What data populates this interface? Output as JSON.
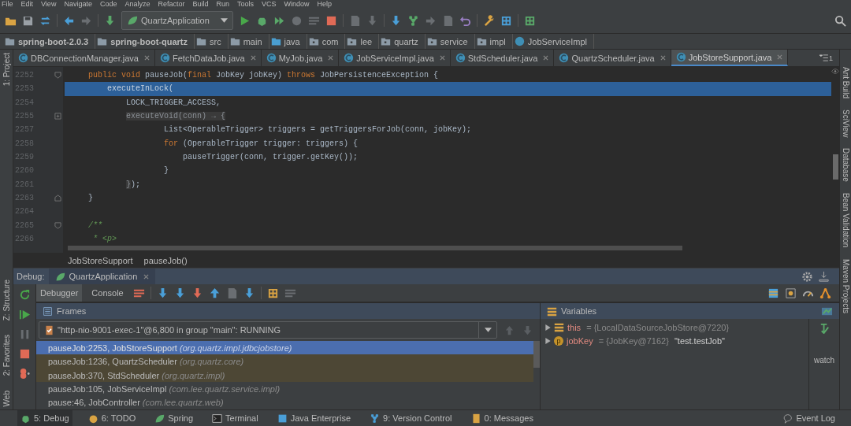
{
  "menu": [
    "File",
    "Edit",
    "View",
    "Navigate",
    "Code",
    "Analyze",
    "Refactor",
    "Build",
    "Run",
    "Tools",
    "VCS",
    "Window",
    "Help"
  ],
  "run_config": {
    "label": "QuartzApplication"
  },
  "breadcrumbs": [
    {
      "label": "spring-boot-2.0.3",
      "kind": "module"
    },
    {
      "label": "spring-boot-quartz",
      "kind": "module"
    },
    {
      "label": "src",
      "kind": "folder"
    },
    {
      "label": "main",
      "kind": "folder"
    },
    {
      "label": "java",
      "kind": "source"
    },
    {
      "label": "com",
      "kind": "package"
    },
    {
      "label": "lee",
      "kind": "package"
    },
    {
      "label": "quartz",
      "kind": "package"
    },
    {
      "label": "service",
      "kind": "package"
    },
    {
      "label": "impl",
      "kind": "package"
    },
    {
      "label": "JobServiceImpl",
      "kind": "class"
    }
  ],
  "left_toolbar": {
    "top": [
      "1: Project"
    ],
    "bottom": [
      "Z: Structure",
      "2: Favorites",
      "Web"
    ]
  },
  "right_toolbar": [
    "Ant Build",
    "SciView",
    "Database",
    "Bean Validation",
    "Maven Projects"
  ],
  "tabs": [
    {
      "label": "DBConnectionManager.java",
      "selected": false
    },
    {
      "label": "FetchDataJob.java",
      "selected": false
    },
    {
      "label": "MyJob.java",
      "selected": false
    },
    {
      "label": "JobServiceImpl.java",
      "selected": false
    },
    {
      "label": "StdScheduler.java",
      "selected": false
    },
    {
      "label": "QuartzScheduler.java",
      "selected": false
    },
    {
      "label": "JobStoreSupport.java",
      "selected": true
    }
  ],
  "tab_overflow": "1",
  "code": [
    {
      "number": "2252",
      "current": false,
      "fold_start": true,
      "segments": [
        {
          "text": "    public void ",
          "kind": "kw"
        },
        {
          "text": "pauseJob(",
          "kind": "plain"
        },
        {
          "text": "final ",
          "kind": "kw"
        },
        {
          "text": "JobKey jobKey) ",
          "kind": "plain"
        },
        {
          "text": "throws ",
          "kind": "kw"
        },
        {
          "text": "JobPersistenceException {",
          "kind": "plain"
        }
      ]
    },
    {
      "number": "2253",
      "current": true,
      "segments": [
        {
          "text": "        executeInLock(",
          "kind": "plain"
        }
      ]
    },
    {
      "number": "2254",
      "current": false,
      "segments": [
        {
          "text": "            LOCK_TRIGGER_ACCESS,",
          "kind": "plain"
        }
      ]
    },
    {
      "number": "2255",
      "current": false,
      "folded": true,
      "segments": [
        {
          "text": "            executeVoid(conn) → {",
          "kind": "folded"
        }
      ]
    },
    {
      "number": "2257",
      "current": false,
      "segments": [
        {
          "text": "                    List<OperableTrigger> triggers = getTriggersForJob(conn, jobKey);",
          "kind": "plain"
        }
      ]
    },
    {
      "number": "2258",
      "current": false,
      "segments": [
        {
          "text": "                    for ",
          "kind": "kw"
        },
        {
          "text": "(OperableTrigger trigger: triggers) {",
          "kind": "plain"
        }
      ]
    },
    {
      "number": "2259",
      "current": false,
      "segments": [
        {
          "text": "                        pauseTrigger(conn, trigger.getKey());",
          "kind": "plain"
        }
      ]
    },
    {
      "number": "2260",
      "current": false,
      "segments": [
        {
          "text": "                    }",
          "kind": "plain"
        }
      ]
    },
    {
      "number": "2261",
      "current": false,
      "segments": [
        {
          "text": "            }",
          "kind": "folded"
        },
        {
          "text": ");",
          "kind": "plain"
        }
      ]
    },
    {
      "number": "2263",
      "current": false,
      "fold_end": true,
      "segments": [
        {
          "text": "    }",
          "kind": "plain"
        }
      ]
    },
    {
      "number": "2264",
      "current": false
    },
    {
      "number": "2265",
      "current": false,
      "fold_start": true,
      "segments": [
        {
          "text": "    /**",
          "kind": "comment"
        }
      ]
    },
    {
      "number": "2266",
      "current": false,
      "segments": [
        {
          "text": "     * <p>",
          "kind": "comment"
        }
      ]
    }
  ],
  "editor_breadcrumbs": [
    "JobStoreSupport",
    "pauseJob()"
  ],
  "debug": {
    "label": "Debug:",
    "session": "QuartzApplication",
    "tabs": [
      {
        "label": "Debugger",
        "selected": true
      },
      {
        "label": "Console",
        "selected": false
      }
    ],
    "frames_title": "Frames",
    "thread": "\"http-nio-9001-exec-1\"@6,800 in group \"main\": RUNNING",
    "frames": [
      {
        "location": "pauseJob:2253, JobStoreSupport",
        "package": "(org.quartz.impl.jdbcjobstore)",
        "selected": true,
        "library": false
      },
      {
        "location": "pauseJob:1236, QuartzScheduler",
        "package": "(org.quartz.core)",
        "selected": false,
        "library": true
      },
      {
        "location": "pauseJob:370, StdScheduler",
        "package": "(org.quartz.impl)",
        "selected": false,
        "library": true
      },
      {
        "location": "pauseJob:105, JobServiceImpl",
        "package": "(com.lee.quartz.service.impl)",
        "selected": false,
        "library": false
      },
      {
        "location": "pause:46, JobController",
        "package": "(com.lee.quartz.web)",
        "selected": false,
        "library": false
      }
    ],
    "variables_title": "Variables",
    "variables": [
      {
        "name": "this",
        "value": "= {LocalDataSourceJobStore@7220}",
        "kind": "field"
      },
      {
        "name": "jobKey",
        "value": "= {JobKey@7162}",
        "string": "\"test.testJob\"",
        "kind": "param",
        "badge": "p"
      }
    ],
    "watches_hint": "watch"
  },
  "status_bar": [
    {
      "label": "5: Debug",
      "selected": true
    },
    {
      "label": "6: TODO",
      "selected": false
    },
    {
      "label": "Spring",
      "selected": false
    },
    {
      "label": "Terminal",
      "selected": false
    },
    {
      "label": "Java Enterprise",
      "selected": false
    },
    {
      "label": "9: Version Control",
      "selected": false
    },
    {
      "label": "0: Messages",
      "selected": false
    }
  ],
  "event_log": "Event Log"
}
